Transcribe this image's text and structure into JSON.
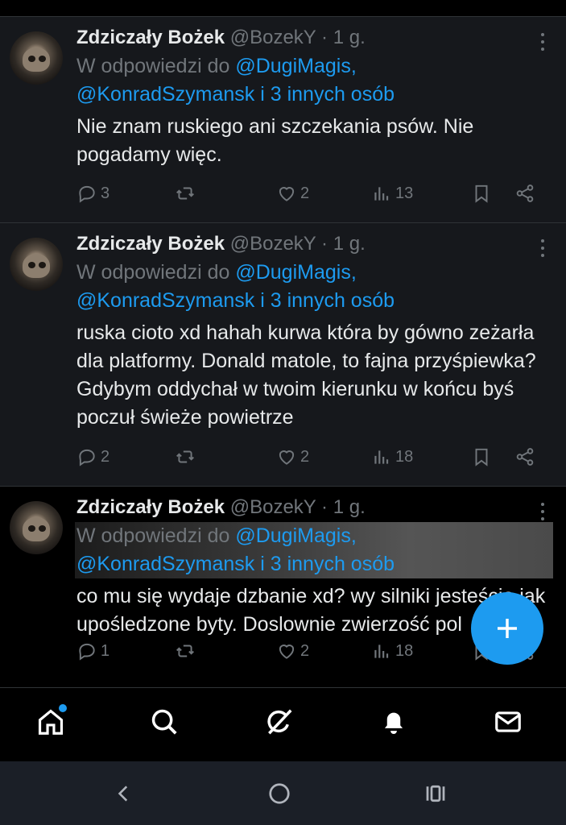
{
  "tweets": [
    {
      "author": "Zdziczały Bożek",
      "handle": "@BozekY",
      "separator": "·",
      "time": "1 g.",
      "reply_prefix": "W odpowiedzi do",
      "reply_to_1": "@DugiMagis,",
      "reply_to_2": "@KonradSzymansk i 3 innych osób",
      "text": "Nie znam ruskiego ani szczekania psów. Nie pogadamy więc.",
      "replies": "3",
      "likes": "2",
      "views": "13"
    },
    {
      "author": "Zdziczały Bożek",
      "handle": "@BozekY",
      "separator": "·",
      "time": "1 g.",
      "reply_prefix": "W odpowiedzi do",
      "reply_to_1": "@DugiMagis,",
      "reply_to_2": "@KonradSzymansk i 3 innych osób",
      "text": "ruska cioto xd hahah kurwa która by gówno zeżarła dla platformy. Donald matole, to fajna przyśpiewka? Gdybym oddychał w twoim kierunku w końcu byś poczuł świeże powietrze",
      "replies": "2",
      "likes": "2",
      "views": "18"
    },
    {
      "author": "Zdziczały Bożek",
      "handle": "@BozekY",
      "separator": "·",
      "time": "1 g.",
      "reply_prefix": "W odpowiedzi do",
      "reply_to_1": "@DugiMagis,",
      "reply_to_2": "@KonradSzymansk i 3 innych osób",
      "text": "co mu się wydaje dzbanie xd? wy silniki jesteście jak upośledzone byty. Doslownie zwierzość pol",
      "replies": "1",
      "likes": "2",
      "views": "18"
    }
  ],
  "icons": {
    "reply": "comment-icon",
    "retweet": "retweet-icon",
    "like": "heart-icon",
    "views": "views-icon",
    "bookmark": "bookmark-icon",
    "share": "share-icon",
    "more": "more-icon"
  },
  "bottom_nav": [
    "home-icon",
    "search-icon",
    "grok-icon",
    "notifications-icon",
    "messages-icon"
  ],
  "system_nav": [
    "back-icon",
    "home-circle-icon",
    "recents-icon"
  ],
  "colors": {
    "accent": "#1d9bf0",
    "muted": "#71767b",
    "text": "#e7e9ea",
    "tweet_bg": "#16181c"
  }
}
